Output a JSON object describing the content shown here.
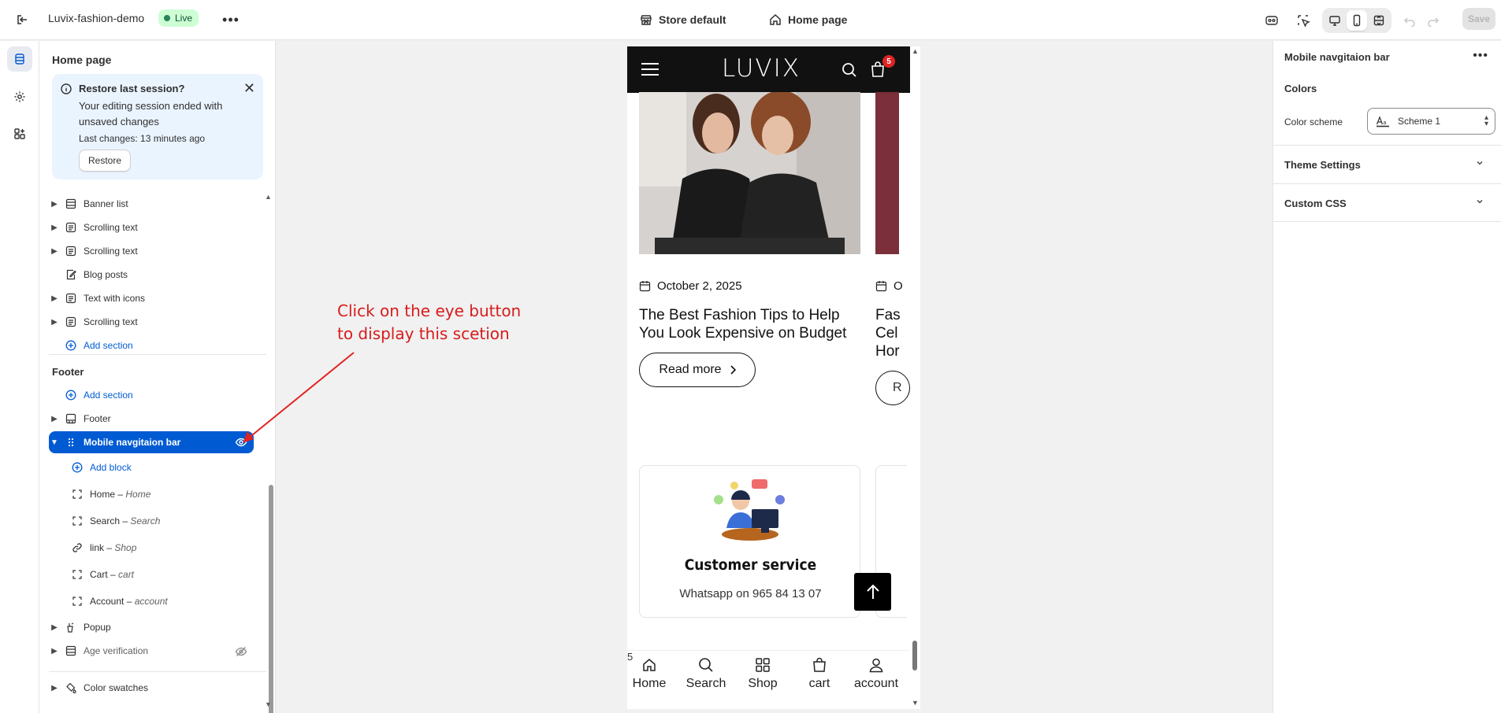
{
  "topbar": {
    "store_name": "Luvix-fashion-demo",
    "status": "Live",
    "template": "Store default",
    "page": "Home page",
    "save": "Save"
  },
  "left": {
    "title": "Home page",
    "banner": {
      "title": "Restore last session?",
      "body": "Your editing session ended with unsaved changes",
      "last": "Last changes: 13 minutes ago",
      "button": "Restore"
    },
    "sections": [
      {
        "label": "Banner list",
        "icon": "layout-icon"
      },
      {
        "label": "Scrolling text",
        "icon": "text-block-icon"
      },
      {
        "label": "Scrolling text",
        "icon": "text-block-icon"
      },
      {
        "label": "Blog posts",
        "icon": "edit-icon"
      },
      {
        "label": "Text with icons",
        "icon": "text-block-icon"
      },
      {
        "label": "Scrolling text",
        "icon": "text-block-icon"
      }
    ],
    "add_section": "Add section",
    "footer_heading": "Footer",
    "footer_add_section": "Add section",
    "footer": "Footer",
    "selected": "Mobile navgitaion bar",
    "add_block": "Add block",
    "blocks": [
      {
        "name": "Home",
        "sep": " – ",
        "sub": "Home"
      },
      {
        "name": "Search",
        "sep": " – ",
        "sub": "Search"
      },
      {
        "name": "link",
        "sep": " – ",
        "sub": "Shop"
      },
      {
        "name": "Cart",
        "sep": " – ",
        "sub": "cart"
      },
      {
        "name": "Account",
        "sep": " – ",
        "sub": "account"
      }
    ],
    "popup": "Popup",
    "age": "Age verification",
    "swatches": "Color swatches"
  },
  "annotation": {
    "line1": "Click on the eye button",
    "line2": "to display this scetion",
    "color": "#d81b1b"
  },
  "preview": {
    "logo": "LUVIX",
    "cart_count": "5",
    "date": "October 2, 2025",
    "date2": "O",
    "post_title": "The Best Fashion Tips to Help You Look Expensive on Budget",
    "post_title2_l1": "Fas",
    "post_title2_l2": "Cel",
    "post_title2_l3": "Hor",
    "read_more": "Read more",
    "read_more2": "R",
    "service_title": "Customer service",
    "service_text": "Whatsapp on 965 84 13 07",
    "nav": [
      {
        "label": "Home",
        "icon": "home-icon"
      },
      {
        "label": "Search",
        "icon": "search-icon"
      },
      {
        "label": "Shop",
        "icon": "grid-icon"
      },
      {
        "label": "cart",
        "icon": "bag-icon"
      },
      {
        "label": "account",
        "icon": "user-icon"
      }
    ],
    "nav_cart_count": "5"
  },
  "right": {
    "title": "Mobile navgitaion bar",
    "colors": "Colors",
    "scheme_label": "Color scheme",
    "scheme_value": "Scheme 1",
    "theme_settings": "Theme Settings",
    "custom_css": "Custom CSS"
  },
  "colors": {
    "accent": "#005bd3",
    "live_bg": "#cdfed4",
    "banner_bg": "#eaf4ff"
  }
}
